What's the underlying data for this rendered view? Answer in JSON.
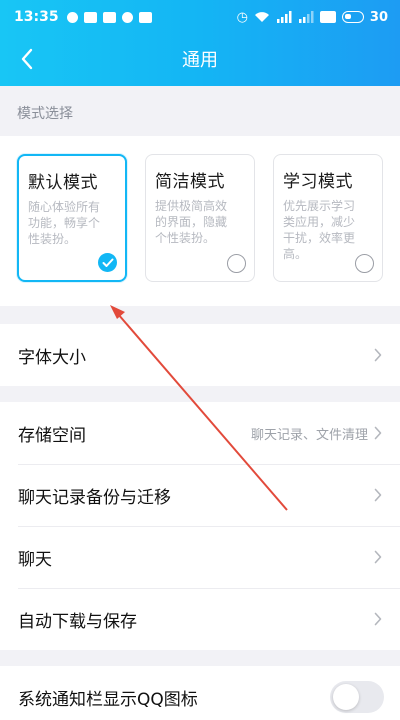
{
  "status_bar": {
    "time": "13:35",
    "battery": "30"
  },
  "header": {
    "title": "通用",
    "back_icon": "chevron-left-icon"
  },
  "mode_section": {
    "label": "模式选择",
    "modes": [
      {
        "title": "默认模式",
        "desc": [
          "随心体验所有",
          "功能，畅享个",
          "性装扮。"
        ],
        "selected": true
      },
      {
        "title": "简洁模式",
        "desc": [
          "提供极简高效",
          "的界面，隐藏",
          "个性装扮。"
        ],
        "selected": false
      },
      {
        "title": "学习模式",
        "desc": [
          "优先展示学习",
          "类应用，减少",
          "干扰，效率更",
          "高。"
        ],
        "selected": false
      }
    ]
  },
  "list": {
    "font_size": {
      "label": "字体大小"
    },
    "storage": {
      "label": "存储空间",
      "sub": "聊天记录、文件清理"
    },
    "backup": {
      "label": "聊天记录备份与迁移"
    },
    "chat": {
      "label": "聊天"
    },
    "auto_download": {
      "label": "自动下载与保存"
    },
    "notify_qq": {
      "label": "系统通知栏显示QQ图标",
      "enabled": false
    }
  },
  "colors": {
    "accent": "#12b7f5",
    "annotation_arrow": "#e24a3b"
  }
}
